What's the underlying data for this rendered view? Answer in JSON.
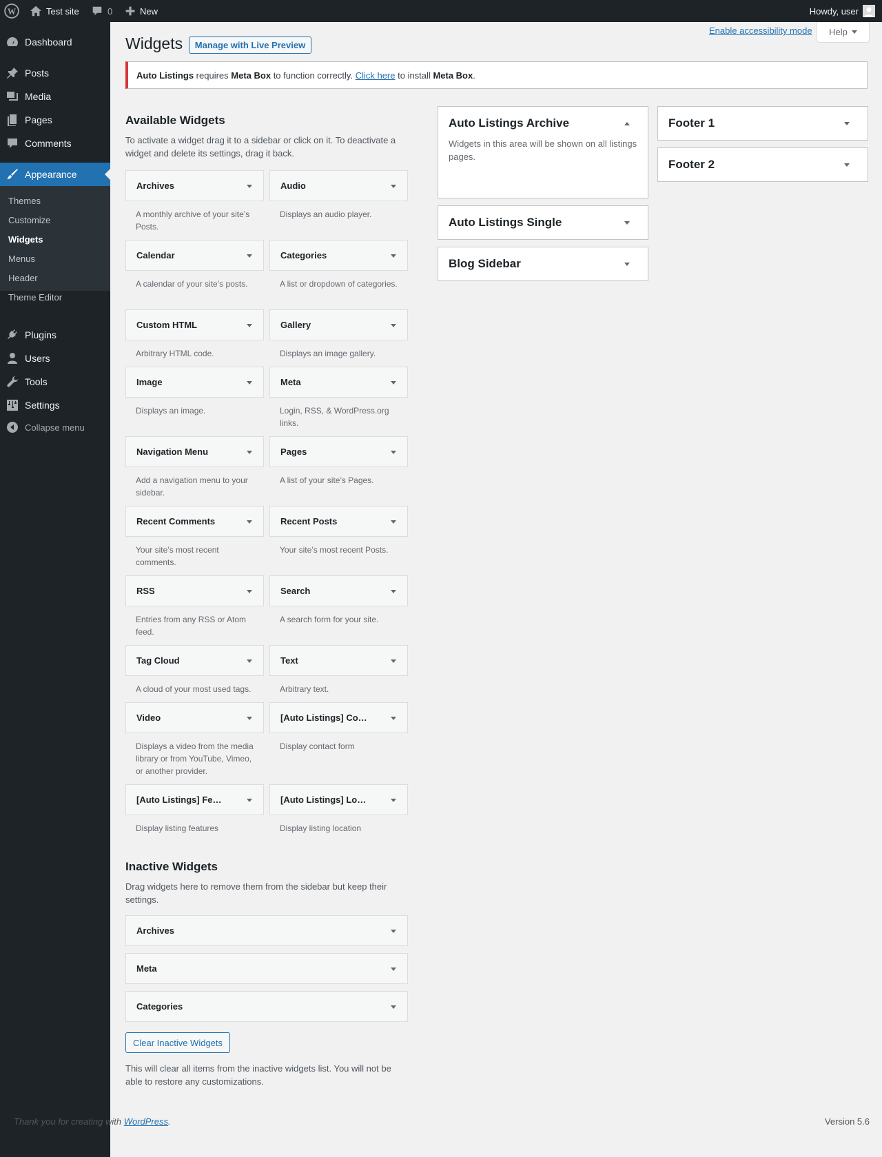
{
  "adminbar": {
    "site_name": "Test site",
    "comments_count": "0",
    "new_label": "New",
    "howdy": "Howdy, user"
  },
  "menu": {
    "dashboard": "Dashboard",
    "posts": "Posts",
    "media": "Media",
    "pages": "Pages",
    "comments": "Comments",
    "appearance": "Appearance",
    "plugins": "Plugins",
    "users": "Users",
    "tools": "Tools",
    "settings": "Settings",
    "collapse": "Collapse menu",
    "appearance_sub": [
      "Themes",
      "Customize",
      "Widgets",
      "Menus",
      "Header",
      "Theme Editor"
    ]
  },
  "header": {
    "title": "Widgets",
    "live_preview": "Manage with Live Preview",
    "accessibility": "Enable accessibility mode",
    "help": "Help"
  },
  "notice": {
    "plugin": "Auto Listings",
    "t1": "requires",
    "dependency": "Meta Box",
    "t2": "to function correctly.",
    "link": "Click here",
    "t3": "to install",
    "dependency2": "Meta Box",
    "end": "."
  },
  "available": {
    "title": "Available Widgets",
    "description": "To activate a widget drag it to a sidebar or click on it. To deactivate a widget and delete its settings, drag it back.",
    "widgets": [
      {
        "name": "Archives",
        "desc": "A monthly archive of your site’s Posts."
      },
      {
        "name": "Audio",
        "desc": "Displays an audio player."
      },
      {
        "name": "Calendar",
        "desc": "A calendar of your site’s posts."
      },
      {
        "name": "Categories",
        "desc": "A list or dropdown of categories."
      },
      {
        "name": "Custom HTML",
        "desc": "Arbitrary HTML code."
      },
      {
        "name": "Gallery",
        "desc": "Displays an image gallery."
      },
      {
        "name": "Image",
        "desc": "Displays an image."
      },
      {
        "name": "Meta",
        "desc": "Login, RSS, & WordPress.org links."
      },
      {
        "name": "Navigation Menu",
        "desc": "Add a navigation menu to your sidebar."
      },
      {
        "name": "Pages",
        "desc": "A list of your site’s Pages."
      },
      {
        "name": "Recent Comments",
        "desc": "Your site’s most recent comments."
      },
      {
        "name": "Recent Posts",
        "desc": "Your site’s most recent Posts."
      },
      {
        "name": "RSS",
        "desc": "Entries from any RSS or Atom feed."
      },
      {
        "name": "Search",
        "desc": "A search form for your site."
      },
      {
        "name": "Tag Cloud",
        "desc": "A cloud of your most used tags."
      },
      {
        "name": "Text",
        "desc": "Arbitrary text."
      },
      {
        "name": "Video",
        "desc": "Displays a video from the media library or from YouTube, Vimeo, or another provider."
      },
      {
        "name": "[Auto Listings] Co…",
        "desc": "Display contact form"
      },
      {
        "name": "[Auto Listings] Fe…",
        "desc": "Display listing features"
      },
      {
        "name": "[Auto Listings] Lo…",
        "desc": "Display listing location"
      }
    ]
  },
  "inactive": {
    "title": "Inactive Widgets",
    "description": "Drag widgets here to remove them from the sidebar but keep their settings.",
    "widgets": [
      "Archives",
      "Meta",
      "Categories"
    ],
    "clear_button": "Clear Inactive Widgets",
    "clear_note": "This will clear all items from the inactive widgets list. You will not be able to restore any customizations."
  },
  "sidebars": {
    "archive": {
      "title": "Auto Listings Archive",
      "desc": "Widgets in this area will be shown on all listings pages."
    },
    "single": {
      "title": "Auto Listings Single"
    },
    "blog": {
      "title": "Blog Sidebar"
    },
    "footer1": {
      "title": "Footer 1"
    },
    "footer2": {
      "title": "Footer 2"
    }
  },
  "footer": {
    "thanks": "Thank you for creating with",
    "wp_link": "WordPress",
    "period": ".",
    "version": "Version 5.6"
  },
  "colors": {
    "accent": "#2271b1",
    "sidebar_bg": "#1d2327",
    "notice_error": "#d63638"
  }
}
